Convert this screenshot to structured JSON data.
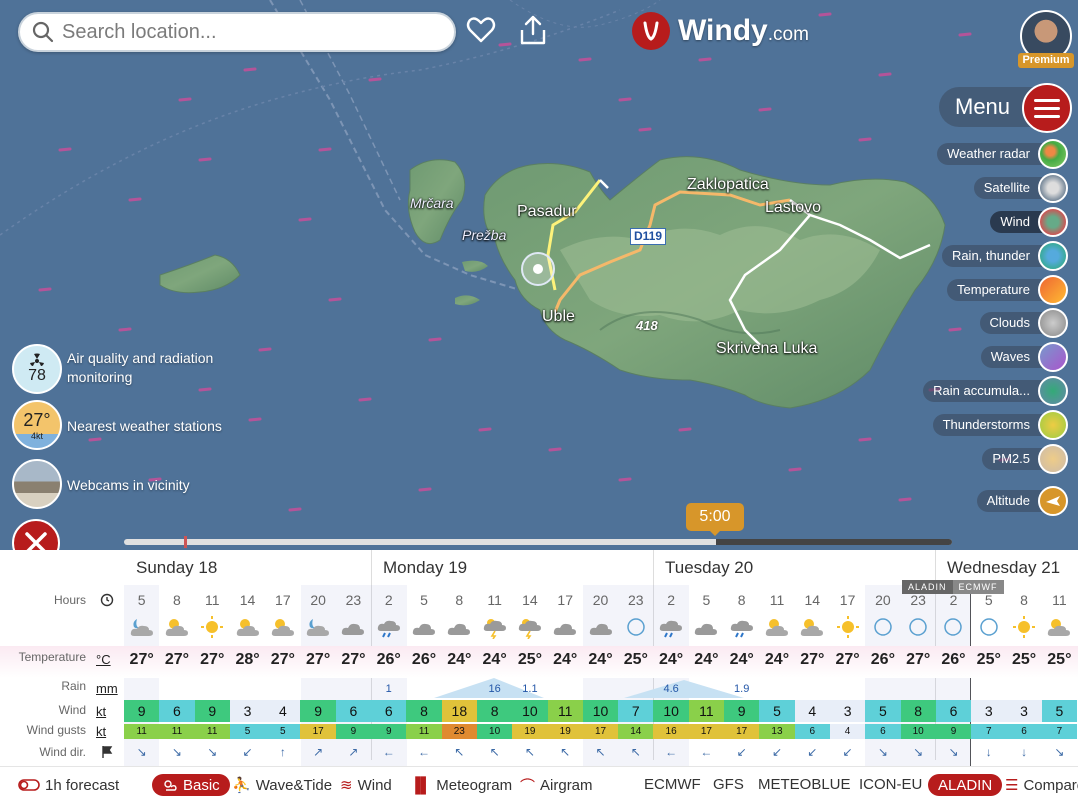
{
  "search": {
    "placeholder": "Search location..."
  },
  "logo": {
    "name": "Windy",
    "suffix": ".com"
  },
  "user": {
    "badge": "Premium"
  },
  "menu": {
    "label": "Menu"
  },
  "layers": [
    {
      "label": "Weather radar",
      "icon": "weather-radar-icon"
    },
    {
      "label": "Satellite",
      "icon": "satellite-icon"
    },
    {
      "label": "Wind",
      "icon": "wind-icon",
      "active": true
    },
    {
      "label": "Rain, thunder",
      "icon": "rain-thunder-icon"
    },
    {
      "label": "Temperature",
      "icon": "temperature-icon"
    },
    {
      "label": "Clouds",
      "icon": "clouds-icon"
    },
    {
      "label": "Waves",
      "icon": "waves-icon"
    },
    {
      "label": "Rain accumula...",
      "icon": "rain-accumulation-icon"
    },
    {
      "label": "Thunderstorms",
      "icon": "thunderstorms-icon"
    },
    {
      "label": "PM2.5",
      "icon": "pm25-icon"
    },
    {
      "label": "Altitude",
      "icon": "altitude-icon"
    }
  ],
  "side": {
    "air": {
      "value": "78",
      "label1": "Air quality and radiation",
      "label2": "monitoring"
    },
    "stations": {
      "value": "27°",
      "sub": "4kt",
      "label": "Nearest weather stations"
    },
    "webcams": {
      "label": "Webcams in vicinity"
    }
  },
  "places": {
    "mrcara": "Mrčara",
    "prezba": "Prežba",
    "pasadur": "Pasadur",
    "uble": "Uble",
    "zaklopatica": "Zaklopatica",
    "lastovo": "Lastovo",
    "skrivena": "Skrivena Luka",
    "road": "D119",
    "peak": "418"
  },
  "timeline": {
    "time": "5:00",
    "progress_fraction": 0.715
  },
  "days": [
    "Sunday 18",
    "Monday 19",
    "Tuesday 20",
    "Wednesday 21"
  ],
  "models_tags": [
    "ALADIN",
    "ECMWF"
  ],
  "labels": {
    "hours": "Hours",
    "temperature": "Temperature",
    "temp_unit": "°C",
    "rain": "Rain",
    "rain_unit": "mm",
    "wind": "Wind",
    "wind_unit": "kt",
    "gusts": "Wind gusts",
    "gusts_unit": "kt",
    "dir": "Wind dir."
  },
  "hours": [
    "5",
    "8",
    "11",
    "14",
    "17",
    "20",
    "23",
    "2",
    "5",
    "8",
    "11",
    "14",
    "17",
    "20",
    "23",
    "2",
    "5",
    "8",
    "11",
    "14",
    "17",
    "20",
    "23",
    "2",
    "5",
    "8",
    "11"
  ],
  "weather": [
    "night-cloud",
    "sun-cloud",
    "sun",
    "sun-cloud",
    "sun-cloud",
    "night-cloud",
    "cloud",
    "rain",
    "cloud",
    "cloud",
    "storm",
    "storm",
    "cloud",
    "cloud",
    "night",
    "rain",
    "cloud",
    "rain",
    "sun-cloud",
    "sun-cloud",
    "sun",
    "night",
    "night",
    "night",
    "night",
    "sun",
    "sun-cloud"
  ],
  "temps": [
    "27°",
    "27°",
    "27°",
    "28°",
    "27°",
    "27°",
    "27°",
    "26°",
    "26°",
    "24°",
    "24°",
    "25°",
    "24°",
    "24°",
    "25°",
    "24°",
    "24°",
    "24°",
    "24°",
    "27°",
    "27°",
    "26°",
    "27°",
    "26°",
    "25°",
    "25°",
    "25°"
  ],
  "rain": [
    "",
    "",
    "",
    "",
    "",
    "",
    "",
    "1",
    "",
    "",
    "16",
    "1.1",
    "",
    "",
    "",
    "4.6",
    "",
    "1.9",
    "",
    "",
    "",
    "",
    "",
    "",
    "",
    "",
    ""
  ],
  "wind": [
    "9",
    "6",
    "9",
    "3",
    "4",
    "9",
    "6",
    "6",
    "8",
    "18",
    "8",
    "10",
    "11",
    "10",
    "7",
    "10",
    "11",
    "9",
    "5",
    "4",
    "3",
    "5",
    "8",
    "6",
    "3",
    "3",
    "5"
  ],
  "gusts": [
    "11",
    "11",
    "11",
    "5",
    "5",
    "17",
    "9",
    "9",
    "11",
    "23",
    "10",
    "19",
    "19",
    "17",
    "14",
    "16",
    "17",
    "17",
    "13",
    "6",
    "4",
    "6",
    "10",
    "9",
    "7",
    "6",
    "7"
  ],
  "dirs": [
    "↘",
    "↘",
    "↘",
    "↙",
    "↑",
    "↗",
    "↗",
    "←",
    "←",
    "↖",
    "↖",
    "↖",
    "↖",
    "↖",
    "↖",
    "←",
    "←",
    "↙",
    "↙",
    "↙",
    "↙",
    "↘",
    "↘",
    "↘",
    "↓",
    "↓",
    "↘"
  ],
  "bottom": {
    "forecast": "1h forecast",
    "basic": "Basic",
    "wave": "Wave&Tide",
    "wind": "Wind",
    "meteogram": "Meteogram",
    "airgram": "Airgram"
  },
  "sources": [
    "ECMWF",
    "GFS",
    "METEOBLUE",
    "ICON-EU",
    "ALADIN",
    "Compare"
  ]
}
